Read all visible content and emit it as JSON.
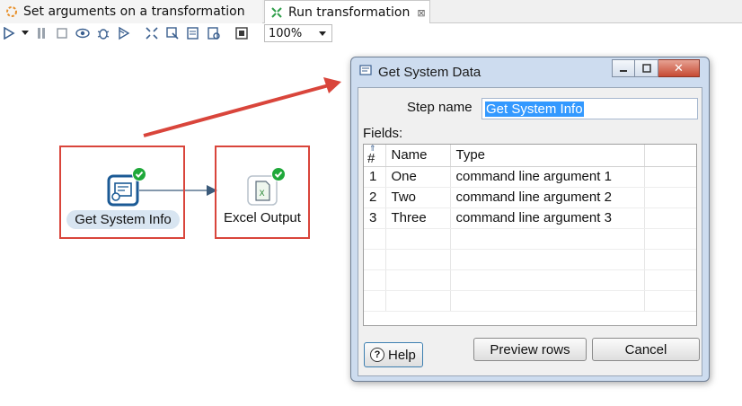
{
  "tabs": [
    {
      "label": "Set arguments on a transformation",
      "active": false
    },
    {
      "label": "Run transformation",
      "active": true
    }
  ],
  "toolbar": {
    "buttons": [
      "run-icon",
      "run-dropdown-icon",
      "pause-icon",
      "stop-icon",
      "preview-icon",
      "debug-icon",
      "replay-icon",
      "verify-icon",
      "impact-icon",
      "sql-icon",
      "explore-db-icon",
      "show-results-icon"
    ],
    "zoom": "100%"
  },
  "canvas": {
    "steps": [
      {
        "label": "Get System Info",
        "status": "ok",
        "selected": true
      },
      {
        "label": "Excel Output",
        "status": "ok",
        "selected": false
      }
    ]
  },
  "dialog": {
    "title": "Get System Data",
    "step_name_label": "Step name",
    "step_name_value": "Get System Info",
    "fields_label": "Fields:",
    "columns": [
      "#",
      "Name",
      "Type"
    ],
    "rows": [
      [
        "1",
        "One",
        "command line argument 1"
      ],
      [
        "2",
        "Two",
        "command line argument 2"
      ],
      [
        "3",
        "Three",
        "command line argument 3"
      ]
    ],
    "buttons": {
      "help": "Help",
      "preview": "Preview rows",
      "cancel": "Cancel"
    }
  },
  "colors": {
    "highlight": "#d9453b",
    "ok_check": "#1fa83a",
    "selection": "#3399ff"
  }
}
